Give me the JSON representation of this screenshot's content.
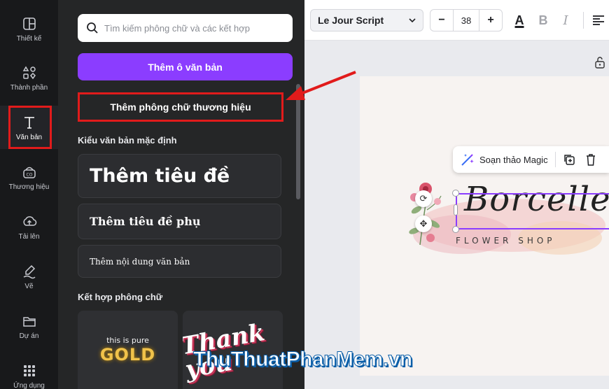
{
  "rail": {
    "items": [
      {
        "label": "Thiết kế",
        "icon": "layout-icon"
      },
      {
        "label": "Thành phần",
        "icon": "shapes-icon"
      },
      {
        "label": "Văn bản",
        "icon": "text-icon"
      },
      {
        "label": "Thương hiệu",
        "icon": "brand-icon"
      },
      {
        "label": "Tải lên",
        "icon": "upload-icon"
      },
      {
        "label": "Vẽ",
        "icon": "draw-icon"
      },
      {
        "label": "Dự án",
        "icon": "folder-icon"
      },
      {
        "label": "Ứng dụng",
        "icon": "apps-icon"
      }
    ],
    "active": "Văn bản"
  },
  "panel": {
    "search_placeholder": "Tìm kiếm phông chữ và các kết hợp",
    "add_textbox": "Thêm ô văn bản",
    "add_brand_font": "Thêm phông chữ thương hiệu",
    "default_styles_title": "Kiểu văn bản mặc định",
    "heading": "Thêm tiêu đề",
    "subheading": "Thêm tiêu đề phụ",
    "body": "Thêm nội dung văn bản",
    "combos_title": "Kết hợp phông chữ",
    "combo1_small": "this is pure",
    "combo1_big": "GOLD",
    "combo2_text": "Thank you"
  },
  "toolbar": {
    "font": "Le Jour Script",
    "font_size": "38",
    "minus": "−",
    "plus": "+",
    "color_letter": "A",
    "bold": "B",
    "italic": "I"
  },
  "canvas": {
    "magic_label": "Soạn thảo Magic",
    "script_text": "Borcelle",
    "subtitle": "FLOWER SHOP"
  },
  "watermark": "ThuThuatPhanMem.vn",
  "colors": {
    "accent": "#8b3dff",
    "highlight": "#e11b1b",
    "panel": "#252627",
    "rail": "#18191b"
  }
}
